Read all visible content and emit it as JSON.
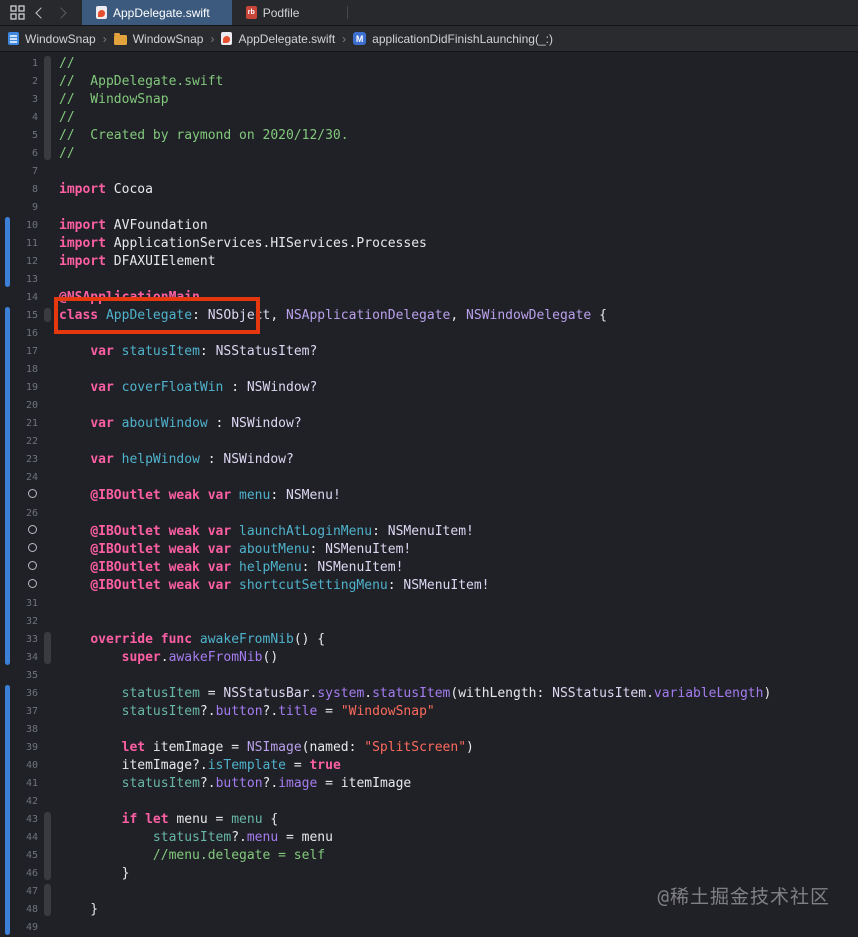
{
  "colors": {
    "editor_bg": "#202126",
    "bar_bg": "#28292c",
    "breadcrumb_bg": "#2a2b2e",
    "active_tab_bg": "#3c5a7d",
    "keyword": "#fc5fa3",
    "comment": "#82c87c",
    "string": "#fc6a5d",
    "declaration": "#4fb2cc",
    "instance": "#67b7a4",
    "member": "#a47cf0",
    "type": "#b9a0ec",
    "type_light": "#ded7f3",
    "plain": "#e8e8ea",
    "change_bar": "#3b7fd6",
    "highlight_box": "#e5380f",
    "line_number": "#6e747c"
  },
  "tab_bar": {
    "tabs": [
      {
        "label": "AppDelegate.swift",
        "icon": "swift-file-icon",
        "active": true
      },
      {
        "label": "Podfile",
        "icon": "ruby-file-icon",
        "active": false
      }
    ]
  },
  "breadcrumb": {
    "items": [
      {
        "label": "WindowSnap",
        "icon": "project-doc-icon"
      },
      {
        "label": "WindowSnap",
        "icon": "folder-icon"
      },
      {
        "label": "AppDelegate.swift",
        "icon": "swift-file-icon"
      },
      {
        "label": "applicationDidFinishLaunching(_:)",
        "icon": "method-icon"
      }
    ]
  },
  "editor": {
    "change_bar_segments": [
      [
        10,
        13
      ],
      [
        15,
        34
      ],
      [
        36,
        49
      ]
    ],
    "fold_segments": [
      [
        1,
        6
      ],
      [
        15,
        15
      ],
      [
        33,
        34
      ],
      [
        43,
        46
      ],
      [
        47,
        48
      ]
    ],
    "outlet_circle_lines": [
      25,
      27,
      28,
      29,
      30
    ],
    "highlighted_line": 12,
    "lines": [
      {
        "n": 1,
        "tok": [
          [
            "cmt",
            "//"
          ]
        ]
      },
      {
        "n": 2,
        "tok": [
          [
            "cmt",
            "//  AppDelegate.swift"
          ]
        ]
      },
      {
        "n": 3,
        "tok": [
          [
            "cmt",
            "//  WindowSnap"
          ]
        ]
      },
      {
        "n": 4,
        "tok": [
          [
            "cmt",
            "//"
          ]
        ]
      },
      {
        "n": 5,
        "tok": [
          [
            "cmt",
            "//  Created by raymond on 2020/12/30."
          ]
        ]
      },
      {
        "n": 6,
        "tok": [
          [
            "cmt",
            "//"
          ]
        ]
      },
      {
        "n": 7,
        "tok": []
      },
      {
        "n": 8,
        "tok": [
          [
            "kw",
            "import"
          ],
          [
            "pln",
            " Cocoa"
          ]
        ]
      },
      {
        "n": 9,
        "tok": []
      },
      {
        "n": 10,
        "tok": [
          [
            "kw",
            "import"
          ],
          [
            "pln",
            " AVFoundation"
          ]
        ]
      },
      {
        "n": 11,
        "tok": [
          [
            "kw",
            "import"
          ],
          [
            "pln",
            " ApplicationServices.HIServices.Processes"
          ]
        ]
      },
      {
        "n": 12,
        "tok": [
          [
            "kw",
            "import"
          ],
          [
            "pln",
            " DFAXUIElement"
          ]
        ]
      },
      {
        "n": 13,
        "tok": []
      },
      {
        "n": 14,
        "tok": [
          [
            "kw",
            "@NSApplicationMain"
          ]
        ]
      },
      {
        "n": 15,
        "tok": [
          [
            "kw",
            "class"
          ],
          [
            "pln",
            " "
          ],
          [
            "decl",
            "AppDelegate"
          ],
          [
            "pln",
            ": "
          ],
          [
            "typel",
            "NSObject"
          ],
          [
            "pln",
            ", "
          ],
          [
            "type",
            "NSApplicationDelegate"
          ],
          [
            "pln",
            ", "
          ],
          [
            "type",
            "NSWindowDelegate"
          ],
          [
            "pln",
            " {"
          ]
        ]
      },
      {
        "n": 16,
        "tok": []
      },
      {
        "n": 17,
        "tok": [
          [
            "pln",
            "    "
          ],
          [
            "kw",
            "var"
          ],
          [
            "pln",
            " "
          ],
          [
            "decl",
            "statusItem"
          ],
          [
            "pln",
            ": "
          ],
          [
            "typel",
            "NSStatusItem?"
          ]
        ]
      },
      {
        "n": 18,
        "tok": []
      },
      {
        "n": 19,
        "tok": [
          [
            "pln",
            "    "
          ],
          [
            "kw",
            "var"
          ],
          [
            "pln",
            " "
          ],
          [
            "decl",
            "coverFloatWin"
          ],
          [
            "pln",
            " : "
          ],
          [
            "typel",
            "NSWindow?"
          ]
        ]
      },
      {
        "n": 20,
        "tok": []
      },
      {
        "n": 21,
        "tok": [
          [
            "pln",
            "    "
          ],
          [
            "kw",
            "var"
          ],
          [
            "pln",
            " "
          ],
          [
            "decl",
            "aboutWindow"
          ],
          [
            "pln",
            " : "
          ],
          [
            "typel",
            "NSWindow?"
          ]
        ]
      },
      {
        "n": 22,
        "tok": []
      },
      {
        "n": 23,
        "tok": [
          [
            "pln",
            "    "
          ],
          [
            "kw",
            "var"
          ],
          [
            "pln",
            " "
          ],
          [
            "decl",
            "helpWindow"
          ],
          [
            "pln",
            " : "
          ],
          [
            "typel",
            "NSWindow?"
          ]
        ]
      },
      {
        "n": 24,
        "tok": []
      },
      {
        "n": 25,
        "tok": [
          [
            "pln",
            "    "
          ],
          [
            "kw",
            "@IBOutlet weak var"
          ],
          [
            "pln",
            " "
          ],
          [
            "decl",
            "menu"
          ],
          [
            "pln",
            ": "
          ],
          [
            "typel",
            "NSMenu!"
          ]
        ]
      },
      {
        "n": 26,
        "tok": []
      },
      {
        "n": 27,
        "tok": [
          [
            "pln",
            "    "
          ],
          [
            "kw",
            "@IBOutlet weak var"
          ],
          [
            "pln",
            " "
          ],
          [
            "decl",
            "launchAtLoginMenu"
          ],
          [
            "pln",
            ": "
          ],
          [
            "typel",
            "NSMenuItem!"
          ]
        ]
      },
      {
        "n": 28,
        "tok": [
          [
            "pln",
            "    "
          ],
          [
            "kw",
            "@IBOutlet weak var"
          ],
          [
            "pln",
            " "
          ],
          [
            "decl",
            "aboutMenu"
          ],
          [
            "pln",
            ": "
          ],
          [
            "typel",
            "NSMenuItem!"
          ]
        ]
      },
      {
        "n": 29,
        "tok": [
          [
            "pln",
            "    "
          ],
          [
            "kw",
            "@IBOutlet weak var"
          ],
          [
            "pln",
            " "
          ],
          [
            "decl",
            "helpMenu"
          ],
          [
            "pln",
            ": "
          ],
          [
            "typel",
            "NSMenuItem!"
          ]
        ]
      },
      {
        "n": 30,
        "tok": [
          [
            "pln",
            "    "
          ],
          [
            "kw",
            "@IBOutlet weak var"
          ],
          [
            "pln",
            " "
          ],
          [
            "decl",
            "shortcutSettingMenu"
          ],
          [
            "pln",
            ": "
          ],
          [
            "typel",
            "NSMenuItem!"
          ]
        ]
      },
      {
        "n": 31,
        "tok": []
      },
      {
        "n": 32,
        "tok": []
      },
      {
        "n": 33,
        "tok": [
          [
            "pln",
            "    "
          ],
          [
            "kw",
            "override func"
          ],
          [
            "pln",
            " "
          ],
          [
            "decl",
            "awakeFromNib"
          ],
          [
            "pln",
            "() {"
          ]
        ]
      },
      {
        "n": 34,
        "tok": [
          [
            "pln",
            "        "
          ],
          [
            "kw",
            "super"
          ],
          [
            "pln",
            "."
          ],
          [
            "mem",
            "awakeFromNib"
          ],
          [
            "pln",
            "()"
          ]
        ]
      },
      {
        "n": 35,
        "tok": []
      },
      {
        "n": 36,
        "tok": [
          [
            "pln",
            "        "
          ],
          [
            "use",
            "statusItem"
          ],
          [
            "pln",
            " = "
          ],
          [
            "typel",
            "NSStatusBar"
          ],
          [
            "pln",
            "."
          ],
          [
            "mem",
            "system"
          ],
          [
            "pln",
            "."
          ],
          [
            "mem",
            "statusItem"
          ],
          [
            "pln",
            "(withLength: "
          ],
          [
            "typel",
            "NSStatusItem"
          ],
          [
            "pln",
            "."
          ],
          [
            "mem",
            "variableLength"
          ],
          [
            "pln",
            ")"
          ]
        ]
      },
      {
        "n": 37,
        "tok": [
          [
            "pln",
            "        "
          ],
          [
            "use",
            "statusItem"
          ],
          [
            "pln",
            "?."
          ],
          [
            "mem",
            "button"
          ],
          [
            "pln",
            "?."
          ],
          [
            "mem",
            "title"
          ],
          [
            "pln",
            " = "
          ],
          [
            "str",
            "\"WindowSnap\""
          ]
        ]
      },
      {
        "n": 38,
        "tok": []
      },
      {
        "n": 39,
        "tok": [
          [
            "pln",
            "        "
          ],
          [
            "kw",
            "let"
          ],
          [
            "pln",
            " itemImage = "
          ],
          [
            "type",
            "NSImage"
          ],
          [
            "pln",
            "(named: "
          ],
          [
            "str",
            "\"SplitScreen\""
          ],
          [
            "pln",
            ")"
          ]
        ]
      },
      {
        "n": 40,
        "tok": [
          [
            "pln",
            "        itemImage?."
          ],
          [
            "decl",
            "isTemplate"
          ],
          [
            "pln",
            " = "
          ],
          [
            "kw",
            "true"
          ]
        ]
      },
      {
        "n": 41,
        "tok": [
          [
            "pln",
            "        "
          ],
          [
            "use",
            "statusItem"
          ],
          [
            "pln",
            "?."
          ],
          [
            "mem",
            "button"
          ],
          [
            "pln",
            "?."
          ],
          [
            "mem",
            "image"
          ],
          [
            "pln",
            " = itemImage"
          ]
        ]
      },
      {
        "n": 42,
        "tok": []
      },
      {
        "n": 43,
        "tok": [
          [
            "pln",
            "        "
          ],
          [
            "kw",
            "if let"
          ],
          [
            "pln",
            " menu = "
          ],
          [
            "use",
            "menu"
          ],
          [
            "pln",
            " {"
          ]
        ]
      },
      {
        "n": 44,
        "tok": [
          [
            "pln",
            "            "
          ],
          [
            "use",
            "statusItem"
          ],
          [
            "pln",
            "?."
          ],
          [
            "mem",
            "menu"
          ],
          [
            "pln",
            " = menu"
          ]
        ]
      },
      {
        "n": 45,
        "tok": [
          [
            "pln",
            "            "
          ],
          [
            "cmt",
            "//menu.delegate = self"
          ]
        ]
      },
      {
        "n": 46,
        "tok": [
          [
            "pln",
            "        }"
          ]
        ]
      },
      {
        "n": 47,
        "tok": []
      },
      {
        "n": 48,
        "tok": [
          [
            "pln",
            "    }"
          ]
        ]
      },
      {
        "n": 49,
        "tok": []
      }
    ]
  },
  "watermark": "@稀土掘金技术社区"
}
